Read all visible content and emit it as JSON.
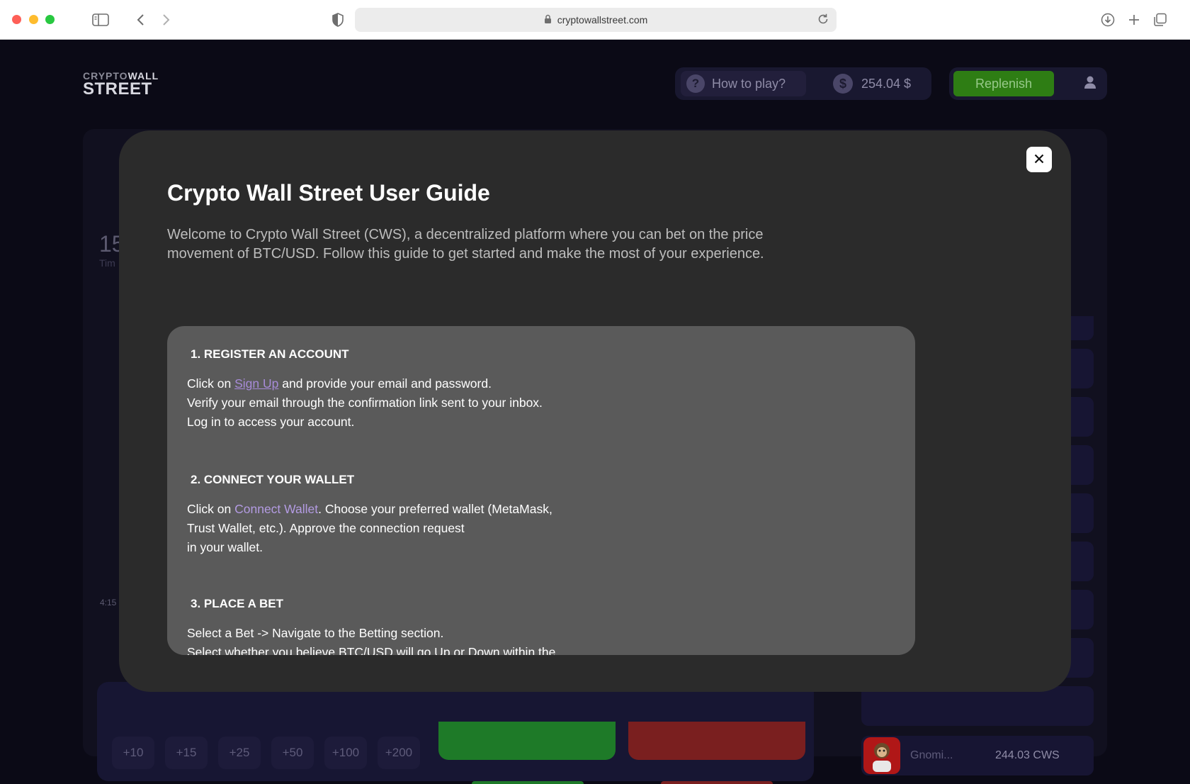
{
  "browser": {
    "url": "cryptowallstreet.com"
  },
  "header": {
    "logo_top_a": "CRYPTO",
    "logo_top_b": "WALL",
    "logo_bottom": "STREET",
    "how_to_play": "How to play?",
    "balance": "254.04 $",
    "replenish": "Replenish"
  },
  "background": {
    "timer_value": "15",
    "timer_label": "Tim",
    "time_tick": "4:15",
    "bet_chips": [
      "+10",
      "+15",
      "+25",
      "+50",
      "+100",
      "+200"
    ],
    "leaderboard_player": {
      "name": "Gnomi...",
      "score": "244.03 CWS"
    }
  },
  "modal": {
    "title": "Crypto Wall Street User Guide",
    "intro": "Welcome to Crypto Wall Street (CWS), a decentralized platform where you can bet on the price movement of BTC/USD. Follow this guide to get started and make the most of your experience.",
    "sections": [
      {
        "title": "1.  REGISTER AN ACCOUNT",
        "line1_pre": "Click on ",
        "line1_link": "Sign Up",
        "line1_post": " and provide your email and password.",
        "line2": "Verify your email through the confirmation link sent to your inbox.",
        "line3": "Log in to access your account."
      },
      {
        "title": "2. CONNECT YOUR WALLET",
        "line1_pre": "Click on ",
        "line1_link": "Connect Wallet",
        "line1_post": ". Choose your preferred wallet (MetaMask,",
        "line2": "Trust Wallet, etc.). Approve the connection request",
        "line3": "in your wallet."
      },
      {
        "title": "3. PLACE A BET",
        "line1": "Select a Bet -> Navigate to the Betting section.",
        "line2": "Select whether you believe BTC/USD will go Up or Down within the"
      }
    ]
  },
  "colors": {
    "page_bg": "#0b0a16",
    "modal_bg": "#2b2b2b",
    "guide_box_bg": "#5a5a5a",
    "accent_link": "#a78bd8",
    "replenish_green": "#2e7d14"
  }
}
